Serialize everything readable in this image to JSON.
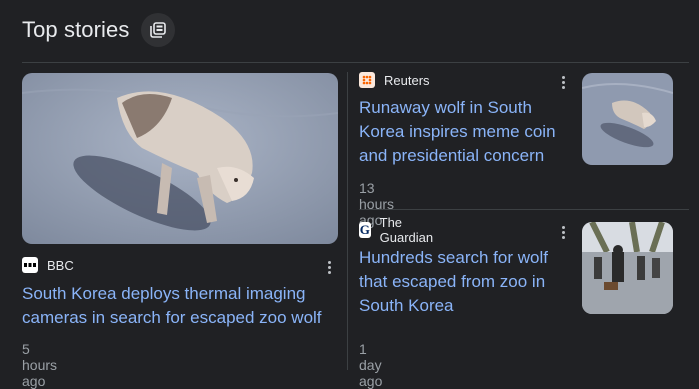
{
  "section": {
    "title": "Top stories",
    "more_icon": "stacked-news-icon"
  },
  "stories": [
    {
      "source": "BBC",
      "source_icon": "bbc-logo-icon",
      "headline": "South Korea deploys thermal imaging cameras in search for escaped zoo wolf",
      "time": "5 hours ago",
      "image": "thermal-wolf-photo"
    },
    {
      "source": "Reuters",
      "source_icon": "reuters-logo-icon",
      "headline": "Runaway wolf in South Korea inspires meme coin and presidential concern",
      "time": "13 hours ago",
      "image": "wolf-thumbnail"
    },
    {
      "source": "The Guardian",
      "source_icon": "guardian-logo-icon",
      "headline": "Hundreds search for wolf that escaped from zoo in South Korea",
      "time": "1 day ago",
      "image": "search-party-thumbnail"
    }
  ],
  "colors": {
    "background": "#202124",
    "link": "#8ab4f8",
    "meta": "#9aa0a6"
  }
}
